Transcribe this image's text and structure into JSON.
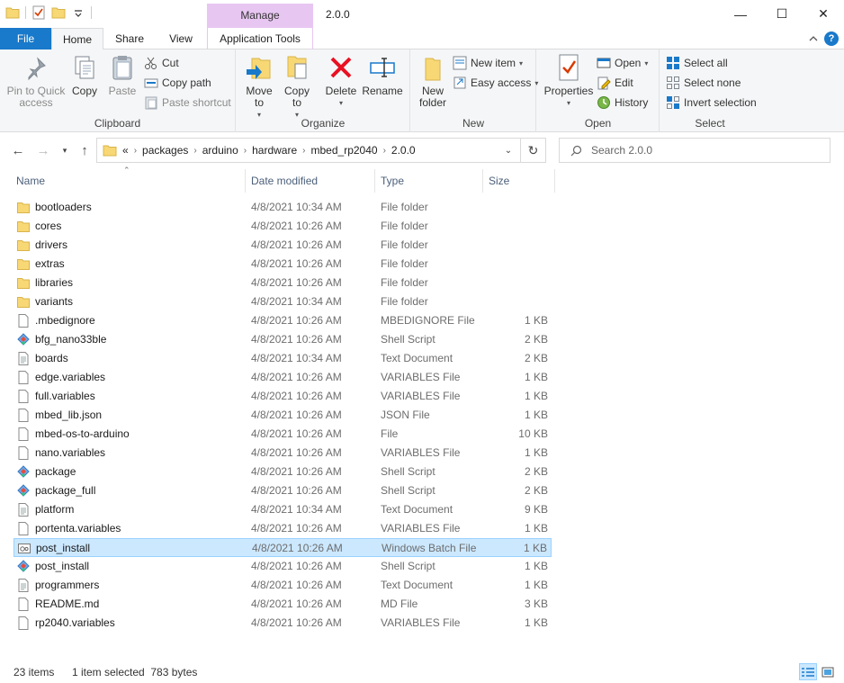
{
  "window": {
    "title": "2.0.0",
    "context_tab": "Manage",
    "minimize": "—",
    "maximize": "☐",
    "close": "✕"
  },
  "tabs": {
    "file": "File",
    "home": "Home",
    "share": "Share",
    "view": "View",
    "app_tools": "Application Tools"
  },
  "ribbon": {
    "clipboard": {
      "label": "Clipboard",
      "pin": "Pin to Quick access",
      "copy": "Copy",
      "paste": "Paste",
      "cut": "Cut",
      "copy_path": "Copy path",
      "paste_shortcut": "Paste shortcut"
    },
    "organize": {
      "label": "Organize",
      "move_to": "Move to",
      "copy_to": "Copy to",
      "delete": "Delete",
      "rename": "Rename"
    },
    "new": {
      "label": "New",
      "new_folder": "New folder",
      "new_item": "New item",
      "easy_access": "Easy access"
    },
    "open": {
      "label": "Open",
      "properties": "Properties",
      "open": "Open",
      "edit": "Edit",
      "history": "History"
    },
    "select": {
      "label": "Select",
      "select_all": "Select all",
      "select_none": "Select none",
      "invert": "Invert selection"
    }
  },
  "address": {
    "overflow": "«",
    "crumbs": [
      "packages",
      "arduino",
      "hardware",
      "mbed_rp2040",
      "2.0.0"
    ],
    "search_placeholder": "Search 2.0.0"
  },
  "columns": {
    "name": "Name",
    "date": "Date modified",
    "type": "Type",
    "size": "Size"
  },
  "files": [
    {
      "name": "bootloaders",
      "date": "4/8/2021 10:34 AM",
      "type": "File folder",
      "size": "",
      "icon": "folder-icon"
    },
    {
      "name": "cores",
      "date": "4/8/2021 10:26 AM",
      "type": "File folder",
      "size": "",
      "icon": "folder-icon"
    },
    {
      "name": "drivers",
      "date": "4/8/2021 10:26 AM",
      "type": "File folder",
      "size": "",
      "icon": "folder-icon"
    },
    {
      "name": "extras",
      "date": "4/8/2021 10:26 AM",
      "type": "File folder",
      "size": "",
      "icon": "folder-icon"
    },
    {
      "name": "libraries",
      "date": "4/8/2021 10:26 AM",
      "type": "File folder",
      "size": "",
      "icon": "folder-icon"
    },
    {
      "name": "variants",
      "date": "4/8/2021 10:34 AM",
      "type": "File folder",
      "size": "",
      "icon": "folder-icon"
    },
    {
      "name": ".mbedignore",
      "date": "4/8/2021 10:26 AM",
      "type": "MBEDIGNORE File",
      "size": "1 KB",
      "icon": "file-icon"
    },
    {
      "name": "bfg_nano33ble",
      "date": "4/8/2021 10:26 AM",
      "type": "Shell Script",
      "size": "2 KB",
      "icon": "script-icon"
    },
    {
      "name": "boards",
      "date": "4/8/2021 10:34 AM",
      "type": "Text Document",
      "size": "2 KB",
      "icon": "text-file-icon"
    },
    {
      "name": "edge.variables",
      "date": "4/8/2021 10:26 AM",
      "type": "VARIABLES File",
      "size": "1 KB",
      "icon": "file-icon"
    },
    {
      "name": "full.variables",
      "date": "4/8/2021 10:26 AM",
      "type": "VARIABLES File",
      "size": "1 KB",
      "icon": "file-icon"
    },
    {
      "name": "mbed_lib.json",
      "date": "4/8/2021 10:26 AM",
      "type": "JSON File",
      "size": "1 KB",
      "icon": "file-icon"
    },
    {
      "name": "mbed-os-to-arduino",
      "date": "4/8/2021 10:26 AM",
      "type": "File",
      "size": "10 KB",
      "icon": "file-icon"
    },
    {
      "name": "nano.variables",
      "date": "4/8/2021 10:26 AM",
      "type": "VARIABLES File",
      "size": "1 KB",
      "icon": "file-icon"
    },
    {
      "name": "package",
      "date": "4/8/2021 10:26 AM",
      "type": "Shell Script",
      "size": "2 KB",
      "icon": "script-icon"
    },
    {
      "name": "package_full",
      "date": "4/8/2021 10:26 AM",
      "type": "Shell Script",
      "size": "2 KB",
      "icon": "script-icon"
    },
    {
      "name": "platform",
      "date": "4/8/2021 10:34 AM",
      "type": "Text Document",
      "size": "9 KB",
      "icon": "text-file-icon"
    },
    {
      "name": "portenta.variables",
      "date": "4/8/2021 10:26 AM",
      "type": "VARIABLES File",
      "size": "1 KB",
      "icon": "file-icon"
    },
    {
      "name": "post_install",
      "date": "4/8/2021 10:26 AM",
      "type": "Windows Batch File",
      "size": "1 KB",
      "icon": "batch-file-icon",
      "selected": true
    },
    {
      "name": "post_install",
      "date": "4/8/2021 10:26 AM",
      "type": "Shell Script",
      "size": "1 KB",
      "icon": "script-icon"
    },
    {
      "name": "programmers",
      "date": "4/8/2021 10:26 AM",
      "type": "Text Document",
      "size": "1 KB",
      "icon": "text-file-icon"
    },
    {
      "name": "README.md",
      "date": "4/8/2021 10:26 AM",
      "type": "MD File",
      "size": "3 KB",
      "icon": "file-icon"
    },
    {
      "name": "rp2040.variables",
      "date": "4/8/2021 10:26 AM",
      "type": "VARIABLES File",
      "size": "1 KB",
      "icon": "file-icon"
    }
  ],
  "status": {
    "items": "23 items",
    "selection": "1 item selected  783 bytes"
  },
  "colors": {
    "file_tab": "#1979ca",
    "manage_tab": "#e8c6f2",
    "selection_bg": "#cce8ff",
    "selection_border": "#99d1ff",
    "folder": "#f8d775"
  }
}
